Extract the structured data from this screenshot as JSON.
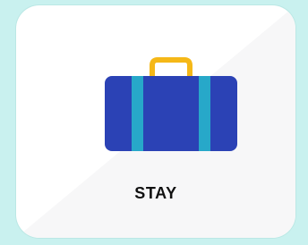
{
  "tile": {
    "label": "STAY",
    "icon": "suitcase-icon"
  },
  "colors": {
    "page_background": "#c9f1ef",
    "card_background": "#ffffff",
    "card_shade": "#f7f7f8",
    "suitcase_body": "#2b42b5",
    "suitcase_stripe": "#27a8c9",
    "suitcase_handle": "#f5b818",
    "label_text": "#111111"
  }
}
